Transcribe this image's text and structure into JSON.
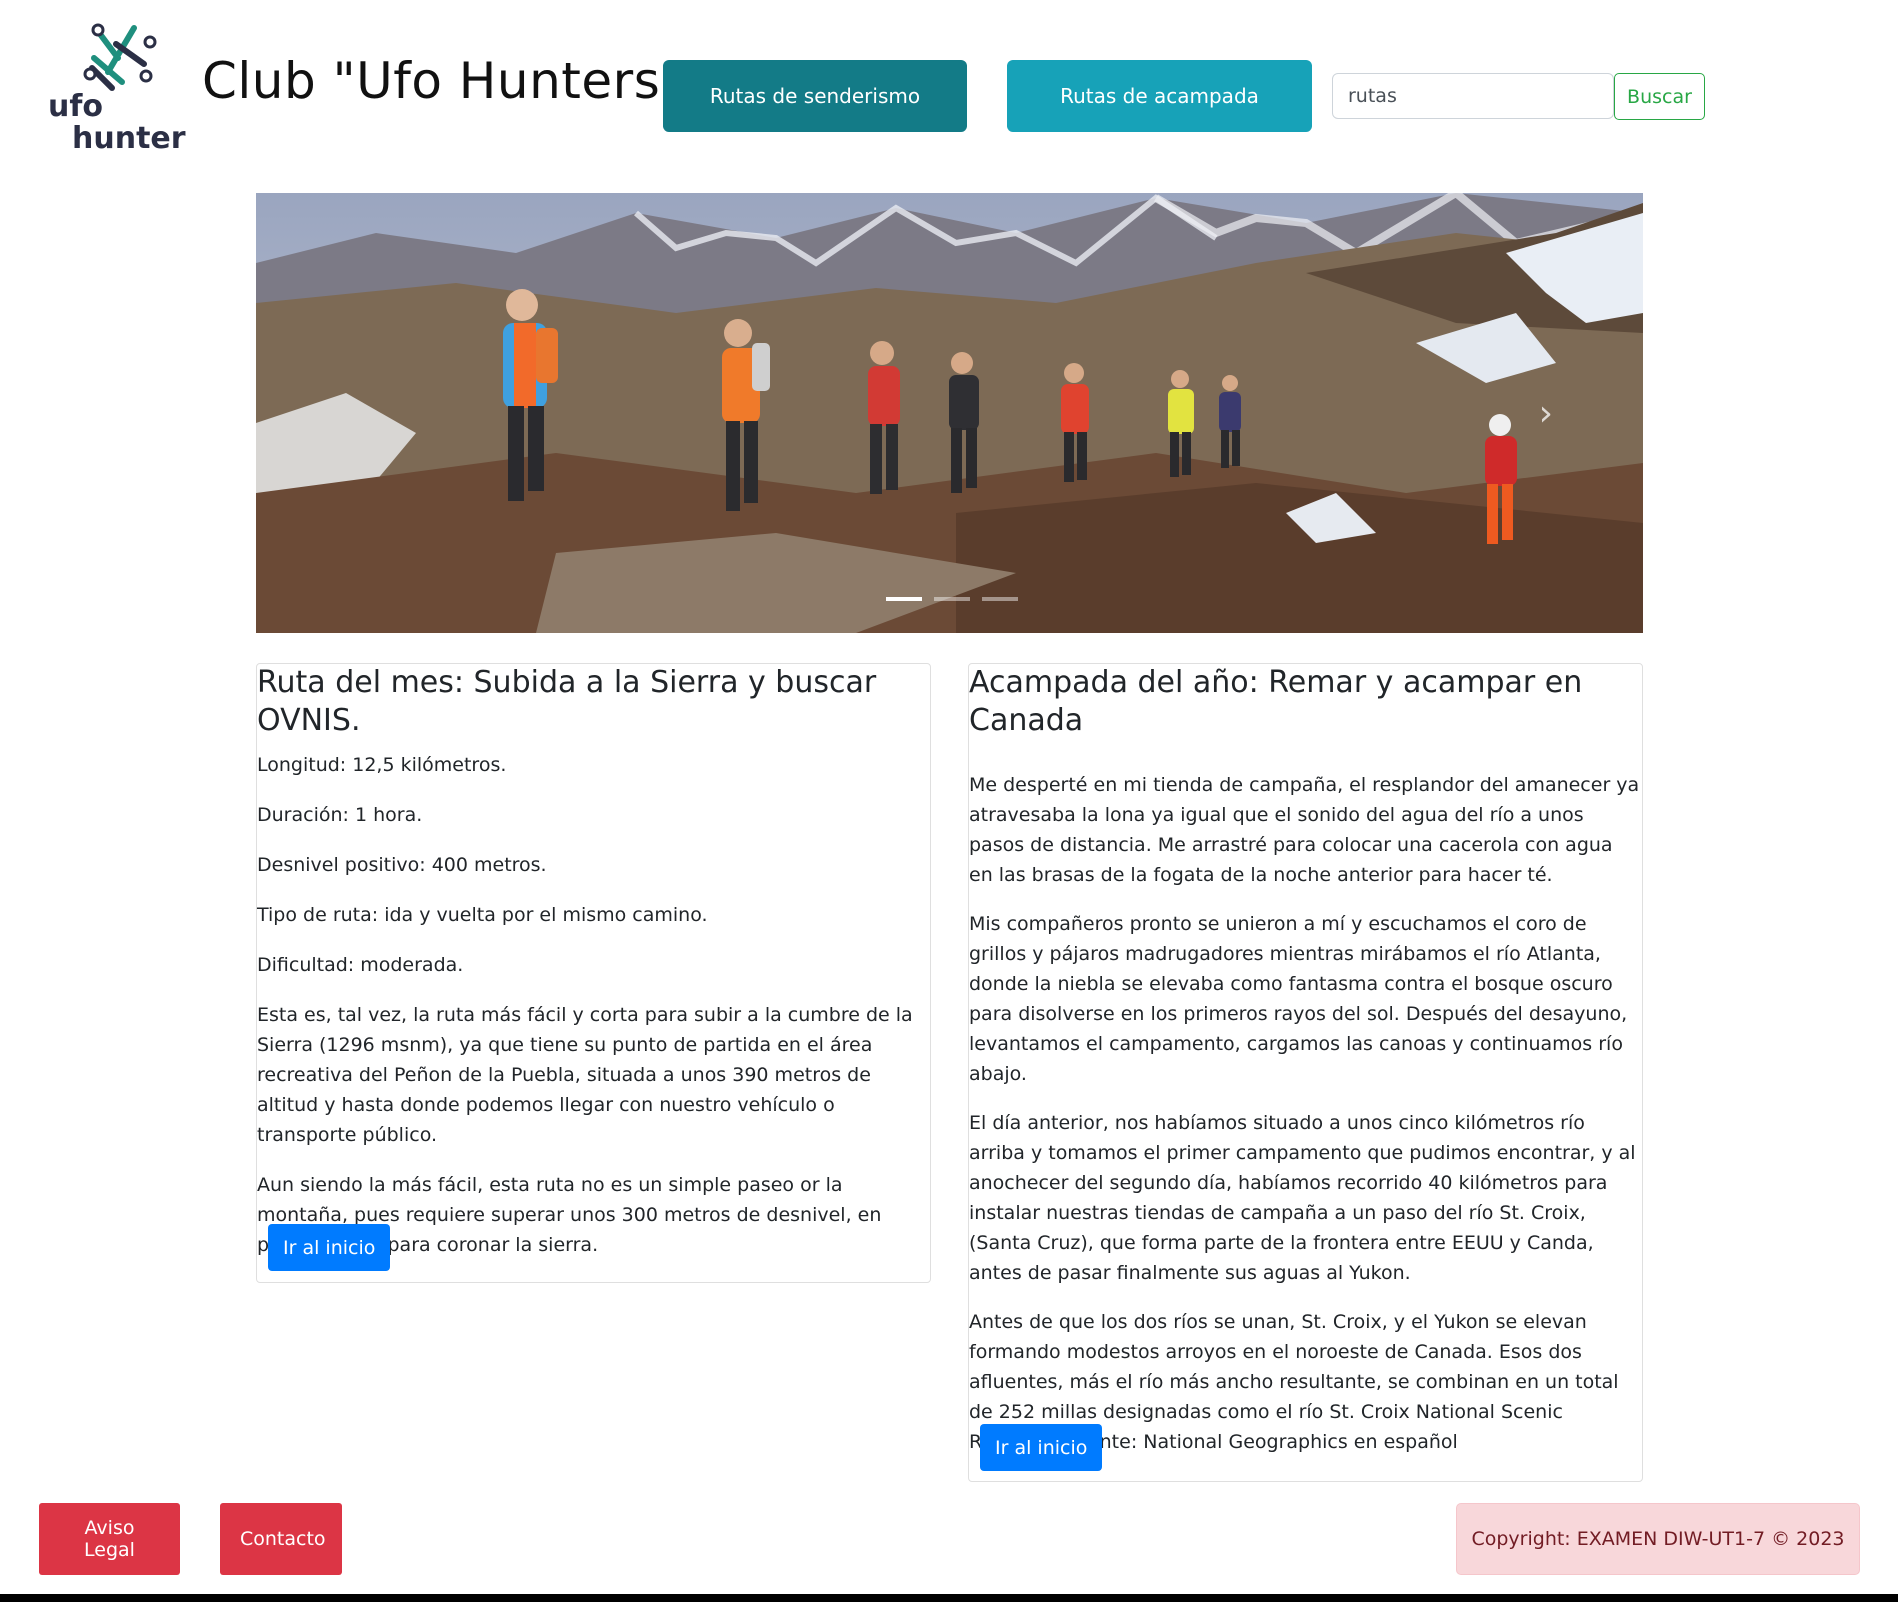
{
  "header": {
    "logo": {
      "text_line1": "ufo",
      "text_line2": "hunter",
      "icon": "ufo-hunter-logo"
    },
    "title": "Club \"Ufo Hunters\"",
    "nav": [
      {
        "label": "Rutas de senderismo",
        "color": "#137b87"
      },
      {
        "label": "Rutas de acampada",
        "color": "#17a2b8"
      }
    ],
    "search": {
      "value": "rutas",
      "button_label": "Buscar"
    }
  },
  "carousel": {
    "slide_count": 3,
    "active_index": 0,
    "next_icon": "chevron-right-icon"
  },
  "route_card": {
    "title": "Ruta del mes: Subida a la Sierra y buscar OVNIS.",
    "paragraphs": [
      "Longitud: 12,5 kilómetros.",
      "Duración: 1 hora.",
      "Desnivel positivo: 400 metros.",
      "Tipo de ruta: ida y vuelta por el mismo camino.",
      "Dificultad: moderada.",
      "Esta es, tal vez, la ruta más fácil y corta para subir a la cumbre de la Sierra (1296 msnm), ya que tiene su punto de partida en el área recreativa del Peñon de la Puebla, situada a unos 390 metros de altitud y hasta donde podemos llegar con nuestro vehículo o transporte público.",
      "Aun siendo la más fácil, esta ruta no es un simple paseo or la montaña, pues requiere superar unos 300 metros de desnivel, en poco tiempo, para coronar la sierra."
    ],
    "button_label": "Ir al inicio"
  },
  "camp_card": {
    "title": "Acampada del año: Remar y acampar en Canada",
    "paragraphs": [
      "Me desperté en mi tienda de campaña, el resplandor del amanecer ya atravesaba la lona ya igual que el sonido del agua del río a unos pasos de distancia. Me arrastré para colocar una cacerola con agua en las brasas de la fogata de la noche anterior para hacer té.",
      "Mis compañeros pronto se unieron a mí y escuchamos el coro de grillos y pájaros madrugadores mientras mirábamos el río Atlanta, donde la niebla se elevaba como fantasma contra el bosque oscuro para disolverse en los primeros rayos del sol. Después del desayuno, levantamos el campamento, cargamos las canoas y continuamos río abajo.",
      "El día anterior, nos habíamos situado a unos cinco kilómetros río arriba y tomamos el primer campamento que pudimos encontrar, y al anochecer del segundo día, habíamos recorrido 40 kilómetros para instalar nuestras tiendas de campaña a un paso del río St. Croix, (Santa Cruz), que forma parte de la frontera entre EEUU y Canda, antes de pasar finalmente sus aguas al Yukon.",
      "Antes de que los dos ríos se unan, St. Croix, y el Yukon se elevan formando modestos arroyos en el noroeste de Canada. Esos dos afluentes, más el río más ancho resultante, se combinan en un total de 252 millas designadas como el río St. Croix National Scenic Riverway. Fuente: National Geographics en español"
    ],
    "button_label": "Ir al inicio"
  },
  "footer": {
    "legal_label": "Aviso Legal",
    "contact_label": "Contacto",
    "copyright": "Copyright: EXAMEN DIW-UT1-7 © 2023"
  },
  "colors": {
    "primary": "#007bff",
    "danger": "#dc3545",
    "success": "#28a745",
    "teal_dark": "#137b87",
    "teal": "#17a2b8"
  }
}
